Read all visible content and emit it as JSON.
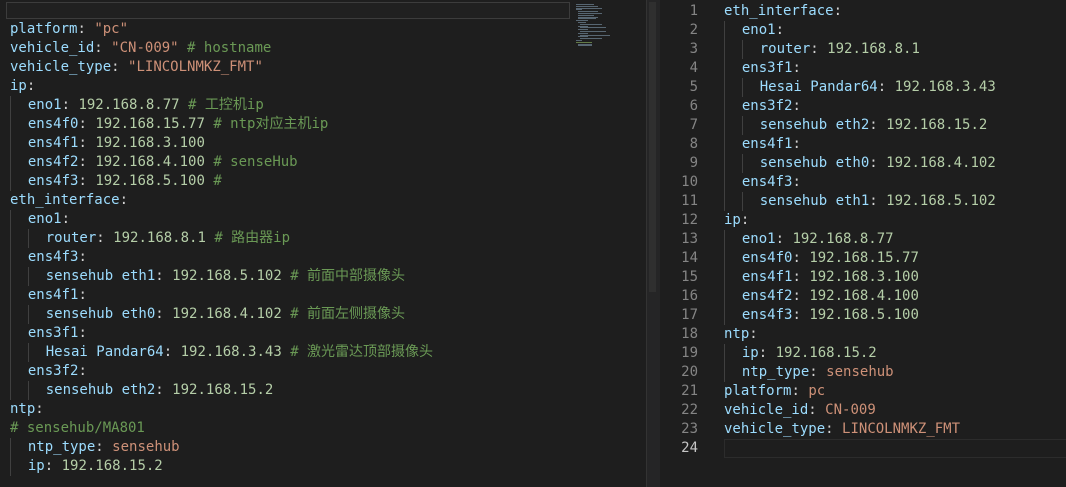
{
  "left_editor": {
    "lines": [
      {
        "indent": 0,
        "key": "platform",
        "value": "\"pc\"",
        "value_type": "string",
        "comment": ""
      },
      {
        "indent": 0,
        "key": "vehicle_id",
        "value": "\"CN-009\"",
        "value_type": "string",
        "comment": "# hostname"
      },
      {
        "indent": 0,
        "key": "vehicle_type",
        "value": "\"LINCOLNMKZ_FMT\"",
        "value_type": "string",
        "comment": ""
      },
      {
        "indent": 0,
        "key": "ip",
        "value": "",
        "value_type": "none",
        "comment": ""
      },
      {
        "indent": 1,
        "key": "eno1",
        "value": "192.168.8.77",
        "value_type": "number",
        "comment": "# 工控机ip"
      },
      {
        "indent": 1,
        "key": "ens4f0",
        "value": "192.168.15.77",
        "value_type": "number",
        "comment": "# ntp对应主机ip"
      },
      {
        "indent": 1,
        "key": "ens4f1",
        "value": "192.168.3.100",
        "value_type": "number",
        "comment": ""
      },
      {
        "indent": 1,
        "key": "ens4f2",
        "value": "192.168.4.100",
        "value_type": "number",
        "comment": "# senseHub"
      },
      {
        "indent": 1,
        "key": "ens4f3",
        "value": "192.168.5.100",
        "value_type": "number",
        "comment": "#"
      },
      {
        "indent": 0,
        "key": "eth_interface",
        "value": "",
        "value_type": "none",
        "comment": ""
      },
      {
        "indent": 1,
        "key": "eno1",
        "value": "",
        "value_type": "none",
        "comment": ""
      },
      {
        "indent": 2,
        "key": "router",
        "value": "192.168.8.1",
        "value_type": "number",
        "comment": "# 路由器ip"
      },
      {
        "indent": 1,
        "key": "ens4f3",
        "value": "",
        "value_type": "none",
        "comment": ""
      },
      {
        "indent": 2,
        "key": "sensehub eth1",
        "value": "192.168.5.102",
        "value_type": "number",
        "comment": "# 前面中部摄像头"
      },
      {
        "indent": 1,
        "key": "ens4f1",
        "value": "",
        "value_type": "none",
        "comment": ""
      },
      {
        "indent": 2,
        "key": "sensehub eth0",
        "value": "192.168.4.102",
        "value_type": "number",
        "comment": "# 前面左侧摄像头"
      },
      {
        "indent": 1,
        "key": "ens3f1",
        "value": "",
        "value_type": "none",
        "comment": ""
      },
      {
        "indent": 2,
        "key": "Hesai Pandar64",
        "value": "192.168.3.43",
        "value_type": "number",
        "comment": "# 激光雷达顶部摄像头"
      },
      {
        "indent": 1,
        "key": "ens3f2",
        "value": "",
        "value_type": "none",
        "comment": ""
      },
      {
        "indent": 2,
        "key": "sensehub eth2",
        "value": "192.168.15.2",
        "value_type": "number",
        "comment": ""
      },
      {
        "indent": 0,
        "key": "ntp",
        "value": "",
        "value_type": "none",
        "comment": ""
      },
      {
        "indent": 0,
        "key": "",
        "value": "",
        "value_type": "none",
        "comment": "# sensehub/MA801"
      },
      {
        "indent": 1,
        "key": "ntp_type",
        "value": "sensehub",
        "value_type": "string",
        "comment": ""
      },
      {
        "indent": 1,
        "key": "ip",
        "value": "192.168.15.2",
        "value_type": "number",
        "comment": ""
      }
    ]
  },
  "right_editor": {
    "line_numbers": [
      "1",
      "2",
      "3",
      "4",
      "5",
      "6",
      "7",
      "8",
      "9",
      "10",
      "11",
      "12",
      "13",
      "14",
      "15",
      "16",
      "17",
      "18",
      "19",
      "20",
      "21",
      "22",
      "23",
      "24"
    ],
    "active_line": "24",
    "lines": [
      {
        "indent": 0,
        "key": "eth_interface",
        "value": "",
        "value_type": "none"
      },
      {
        "indent": 1,
        "key": "eno1",
        "value": "",
        "value_type": "none"
      },
      {
        "indent": 2,
        "key": "router",
        "value": "192.168.8.1",
        "value_type": "number"
      },
      {
        "indent": 1,
        "key": "ens3f1",
        "value": "",
        "value_type": "none"
      },
      {
        "indent": 2,
        "key": "Hesai Pandar64",
        "value": "192.168.3.43",
        "value_type": "number"
      },
      {
        "indent": 1,
        "key": "ens3f2",
        "value": "",
        "value_type": "none"
      },
      {
        "indent": 2,
        "key": "sensehub eth2",
        "value": "192.168.15.2",
        "value_type": "number"
      },
      {
        "indent": 1,
        "key": "ens4f1",
        "value": "",
        "value_type": "none"
      },
      {
        "indent": 2,
        "key": "sensehub eth0",
        "value": "192.168.4.102",
        "value_type": "number"
      },
      {
        "indent": 1,
        "key": "ens4f3",
        "value": "",
        "value_type": "none"
      },
      {
        "indent": 2,
        "key": "sensehub eth1",
        "value": "192.168.5.102",
        "value_type": "number"
      },
      {
        "indent": 0,
        "key": "ip",
        "value": "",
        "value_type": "none"
      },
      {
        "indent": 1,
        "key": "eno1",
        "value": "192.168.8.77",
        "value_type": "number"
      },
      {
        "indent": 1,
        "key": "ens4f0",
        "value": "192.168.15.77",
        "value_type": "number"
      },
      {
        "indent": 1,
        "key": "ens4f1",
        "value": "192.168.3.100",
        "value_type": "number"
      },
      {
        "indent": 1,
        "key": "ens4f2",
        "value": "192.168.4.100",
        "value_type": "number"
      },
      {
        "indent": 1,
        "key": "ens4f3",
        "value": "192.168.5.100",
        "value_type": "number"
      },
      {
        "indent": 0,
        "key": "ntp",
        "value": "",
        "value_type": "none"
      },
      {
        "indent": 1,
        "key": "ip",
        "value": "192.168.15.2",
        "value_type": "number"
      },
      {
        "indent": 1,
        "key": "ntp_type",
        "value": "sensehub",
        "value_type": "string"
      },
      {
        "indent": 0,
        "key": "platform",
        "value": "pc",
        "value_type": "string"
      },
      {
        "indent": 0,
        "key": "vehicle_id",
        "value": "CN-009",
        "value_type": "string"
      },
      {
        "indent": 0,
        "key": "vehicle_type",
        "value": "LINCOLNMKZ_FMT",
        "value_type": "string"
      },
      {
        "indent": 0,
        "key": "",
        "value": "",
        "value_type": "none"
      }
    ]
  },
  "colors": {
    "background": "#1e1e1e",
    "key": "#9cdcfe",
    "string": "#ce9178",
    "number": "#b5cea8",
    "comment": "#6a9955",
    "punctuation": "#d4d4d4",
    "line_number": "#858585"
  }
}
